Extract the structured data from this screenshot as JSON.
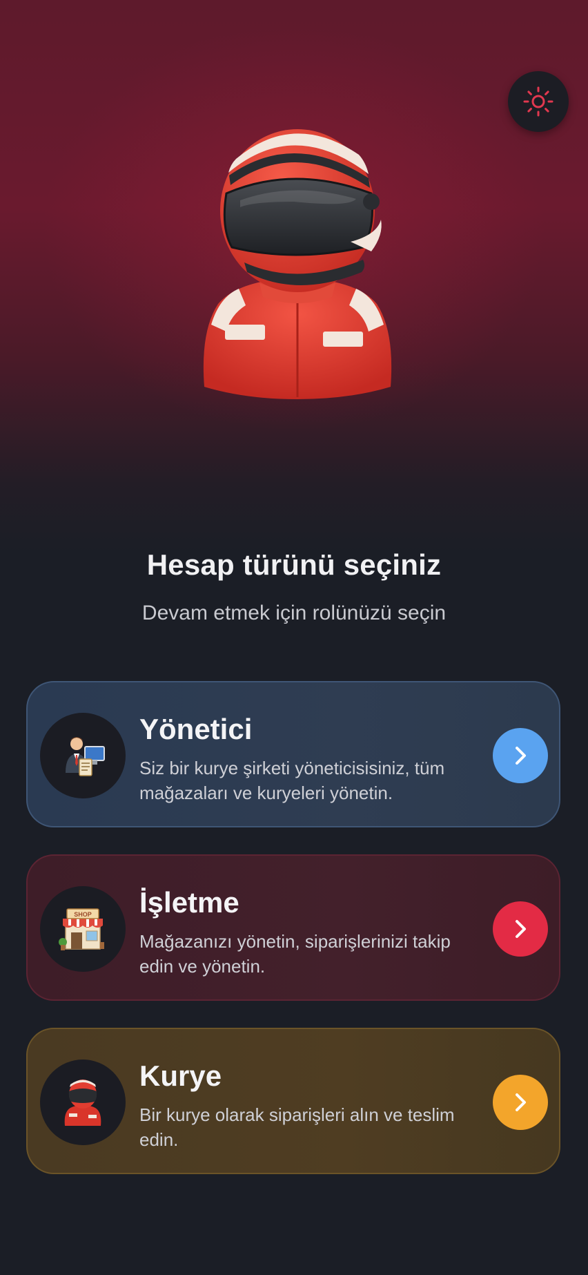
{
  "header": {
    "theme_toggle_icon": "sun-icon",
    "hero_icon": "racing-courier-avatar"
  },
  "intro": {
    "title": "Hesap türünü seçiniz",
    "subtitle": "Devam etmek için rolünüzü seçin"
  },
  "roles": [
    {
      "title": "Yönetici",
      "description": "Siz bir kurye şirketi yöneticisisiniz, tüm mağazaları ve kuryeleri yönetin.",
      "icon": "manager-icon",
      "accent": "#5aa3f0"
    },
    {
      "title": "İşletme",
      "description": "Mağazanızı yönetin, siparişlerinizi takip edin ve yönetin.",
      "icon": "shop-icon",
      "shop_sign": "SHOP",
      "accent": "#e32b45"
    },
    {
      "title": "Kurye",
      "description": "Bir kurye olarak siparişleri alın ve teslim edin.",
      "icon": "courier-icon",
      "accent": "#f3a52b"
    }
  ],
  "colors": {
    "background": "#1b1e26",
    "header_gradient": "#6a1a2e",
    "theme_icon": "#e2384f"
  }
}
